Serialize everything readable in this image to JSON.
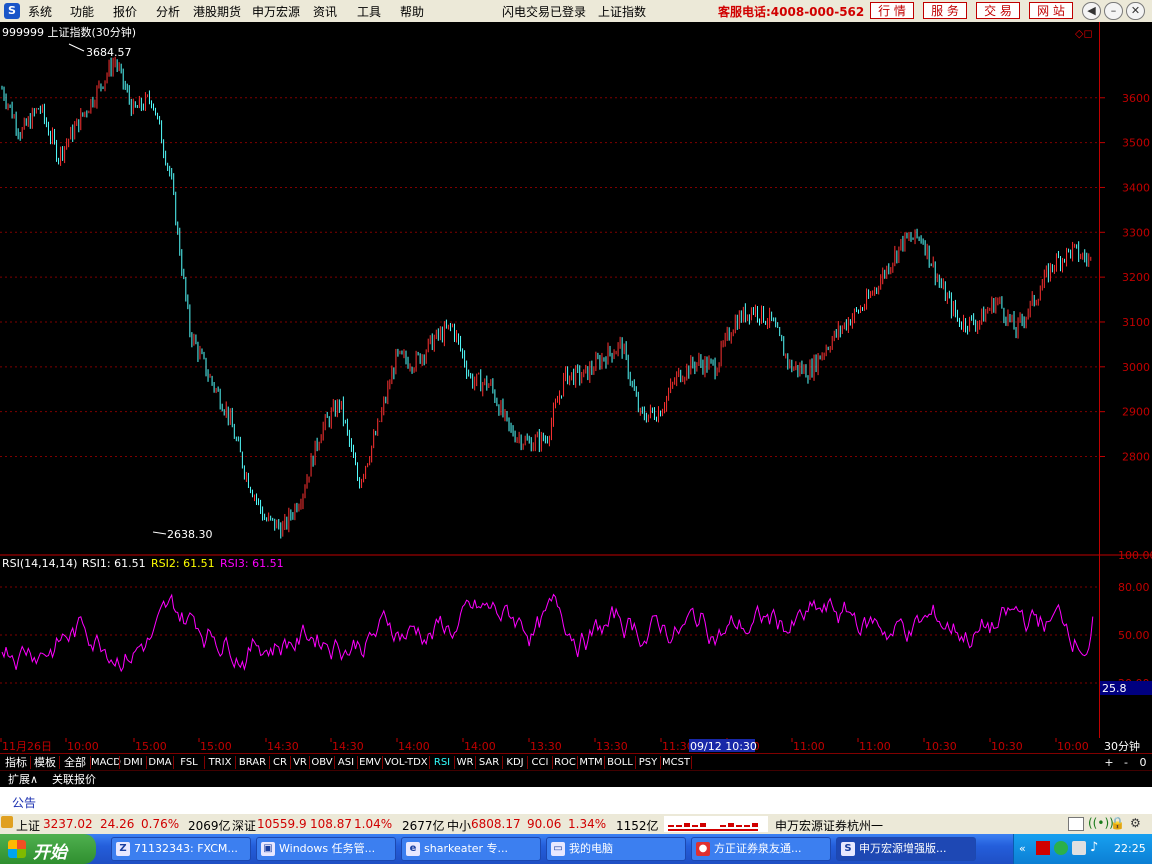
{
  "menu": {
    "logo": "S",
    "items": [
      "系统",
      "功能",
      "报价",
      "分析",
      "港股期货",
      "申万宏源",
      "资讯",
      "工具",
      "帮助"
    ],
    "login_status": "闪电交易已登录",
    "current_index": "上证指数",
    "hotline": "客服电话:4008-000-562",
    "top_buttons": [
      "行 情",
      "服 务",
      "交 易",
      "网 站"
    ]
  },
  "chart": {
    "title": "999999 上证指数(30分钟)",
    "high_label": "3684.57",
    "low_label": "2638.30",
    "rsi_label": "RSI(14,14,14)",
    "rsi1": "RSI1: 61.51",
    "rsi2": "RSI2: 61.51",
    "rsi3": "RSI3: 61.51",
    "rsi_badge": "25.8",
    "period": "30分钟",
    "time_labels": [
      "11月26日",
      "10:00",
      "15:00",
      "15:00",
      "14:30",
      "14:30",
      "14:00",
      "14:00",
      "13:30",
      "13:30",
      "11:30",
      "10:30",
      "11:00",
      "11:00",
      "10:30",
      "10:30",
      "10:00"
    ],
    "cursor_label": "09/12 10:30",
    "colors": {
      "up": "#ff3232",
      "down": "#54ffff",
      "rsi": "#ff00ff",
      "grid": "#800000",
      "axis": "#c00000"
    }
  },
  "chart_data": {
    "type": "candlestick",
    "title": "999999 上证指数(30分钟)",
    "ylim": [
      2600,
      3720
    ],
    "yticks": [
      2800,
      2900,
      3000,
      3100,
      3200,
      3300,
      3400,
      3500,
      3600
    ],
    "price_path": [
      3620,
      3520,
      3580,
      3470,
      3540,
      3610,
      3684.57,
      3570,
      3600,
      3420,
      3080,
      2980,
      2900,
      2760,
      2660,
      2638.3,
      2720,
      2860,
      2920,
      2740,
      2860,
      3020,
      3010,
      3060,
      3090,
      2970,
      2960,
      2860,
      2830,
      2840,
      2980,
      2980,
      3020,
      3050,
      2890,
      2900,
      2980,
      3010,
      3000,
      3100,
      3130,
      3100,
      3000,
      2990,
      3050,
      3100,
      3140,
      3210,
      3280,
      3290,
      3180,
      3100,
      3100,
      3150,
      3080,
      3150,
      3230,
      3260,
      3235
    ],
    "rsi_ylim": [
      0,
      110
    ],
    "rsi_yticks": [
      20,
      50,
      80,
      100
    ],
    "rsi_last": 61.51
  },
  "tabs": [
    "指标",
    "模板",
    "全部",
    "MACD",
    "DMI",
    "DMA",
    "FSL",
    "TRIX",
    "BRAR",
    "CR",
    "VR",
    "OBV",
    "ASI",
    "EMV",
    "VOL-TDX",
    "RSI",
    "WR",
    "SAR",
    "KDJ",
    "CCI",
    "ROC",
    "MTM",
    "BOLL",
    "PSY",
    "MCST"
  ],
  "tab_selected": "RSI",
  "tab_right": [
    "+",
    "-",
    "0"
  ],
  "ext_tabs": [
    "扩展∧",
    "关联报价"
  ],
  "notice": "公告",
  "status": {
    "sh_label": "上证",
    "sh_value": "3237.02",
    "sh_change": "24.26",
    "sh_pct": "0.76%",
    "sh_amount": "2069亿",
    "sz_label": "深证",
    "sz_value": "10559.9",
    "sz_change": "108.87",
    "sz_pct": "1.04%",
    "sz_amount": "2677亿",
    "zx_label": "中小",
    "zx_value": "6808.17",
    "zx_change": "90.06",
    "zx_pct": "1.34%",
    "zx_amount": "1152亿",
    "broker": "申万宏源证券杭州一"
  },
  "taskbar": {
    "start": "开始",
    "tasks": [
      "71132343: FXCM...",
      "Windows 任务管...",
      "sharkeater 专...",
      "我的电脑",
      "方正证券泉友通...",
      "申万宏源增强版..."
    ],
    "clock": "22:25"
  }
}
